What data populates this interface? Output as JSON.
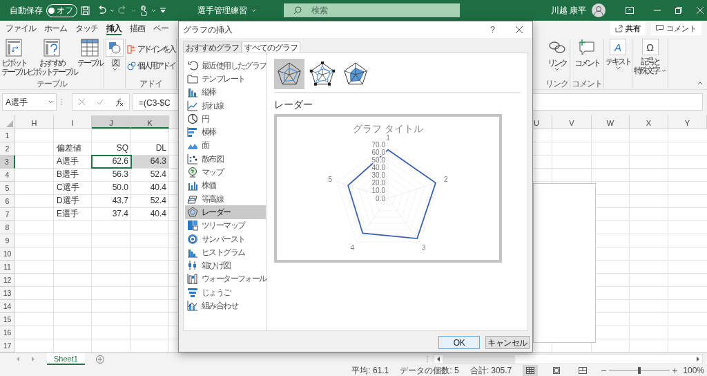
{
  "title_bar": {
    "autosave_label": "自動保存",
    "autosave_toggle": {
      "label": "オフ",
      "on": false
    },
    "file_name": "選手管理練習",
    "search": {
      "placeholder": "検索"
    },
    "user_name": "川越 康平"
  },
  "ribbon": {
    "tabs": [
      {
        "label": "ファイル",
        "selected": false
      },
      {
        "label": "ホーム",
        "selected": false
      },
      {
        "label": "タッチ",
        "selected": false
      },
      {
        "label": "挿入",
        "selected": true
      },
      {
        "label": "描画",
        "selected": false
      },
      {
        "label": "ペー",
        "selected": false
      }
    ],
    "share_button": "共有",
    "comment_button": "コメント",
    "left_groups": [
      {
        "label": "テーブル",
        "commands": [
          {
            "kind": "pivot",
            "lines": [
              "ピボット",
              "テーブル"
            ],
            "dropdown": false
          },
          {
            "kind": "recommended_pivot",
            "lines": [
              "おすすめ",
              "ピボットテーブル"
            ],
            "dropdown": false
          },
          {
            "kind": "table",
            "lines": [
              "テーブル"
            ],
            "dropdown": false
          }
        ]
      },
      {
        "commands": [
          {
            "kind": "illustrations",
            "lines": [
              "図"
            ],
            "dropdown": true
          }
        ]
      },
      {
        "label": "アドイ",
        "commands": [
          {
            "kind": "get_addins",
            "lines": [
              "アドインを入"
            ],
            "dropdown": false
          },
          {
            "kind": "my_addins",
            "lines": [
              "個人用アドイ"
            ],
            "dropdown": false
          }
        ]
      }
    ],
    "right_groups": [
      {
        "label": "リンク",
        "commands": [
          {
            "kind": "link",
            "lines": [
              "リンク"
            ],
            "dropdown": true
          }
        ]
      },
      {
        "label": "コメント",
        "commands": [
          {
            "kind": "comment",
            "lines": [
              "コメント"
            ],
            "dropdown": false
          }
        ]
      },
      {
        "commands": [
          {
            "kind": "text",
            "glyph": "A",
            "lines": [
              "テキスト"
            ],
            "dropdown": true
          }
        ]
      },
      {
        "commands": [
          {
            "kind": "symbols",
            "glyph": "Ω",
            "lines": [
              "記号と",
              "特殊文字"
            ],
            "dropdown": true
          }
        ]
      }
    ]
  },
  "formula_bar": {
    "name_box": "A選手",
    "formula": "=(C3-$C"
  },
  "sheet": {
    "columns": [
      {
        "label": "H",
        "selected": false
      },
      {
        "label": "I",
        "selected": false
      },
      {
        "label": "J",
        "selected": true
      },
      {
        "label": "K",
        "selected": true
      },
      {
        "label": "U",
        "selected": false
      },
      {
        "label": "V",
        "selected": false
      },
      {
        "label": "W",
        "selected": false
      },
      {
        "label": "X",
        "selected": false
      },
      {
        "label": "Y",
        "selected": false
      }
    ],
    "rows": [
      {
        "label": "1",
        "selected": false
      },
      {
        "label": "2",
        "selected": false,
        "cells": [
          {
            "kind": "text",
            "text": "偏差値",
            "selected": false,
            "active": false
          },
          {
            "kind": "number",
            "text": "SQ",
            "selected": false,
            "active": false
          },
          {
            "kind": "number",
            "text": "DL",
            "selected": false,
            "active": false
          }
        ]
      },
      {
        "label": "3",
        "selected": true,
        "cells": [
          {
            "kind": "text",
            "text": "A選手",
            "selected": false,
            "active": false
          },
          {
            "kind": "number",
            "text": "62.6",
            "selected": true,
            "active": true
          },
          {
            "kind": "number",
            "text": "64.3",
            "selected": true,
            "active": false
          }
        ]
      },
      {
        "label": "4",
        "selected": false,
        "cells": [
          {
            "kind": "text",
            "text": "B選手",
            "selected": false,
            "active": false
          },
          {
            "kind": "number",
            "text": "56.3",
            "selected": false,
            "active": false
          },
          {
            "kind": "number",
            "text": "52.4",
            "selected": false,
            "active": false
          }
        ]
      },
      {
        "label": "5",
        "selected": false,
        "cells": [
          {
            "kind": "text",
            "text": "C選手",
            "selected": false,
            "active": false
          },
          {
            "kind": "number",
            "text": "50.0",
            "selected": false,
            "active": false
          },
          {
            "kind": "number",
            "text": "40.4",
            "selected": false,
            "active": false
          }
        ]
      },
      {
        "label": "6",
        "selected": false,
        "cells": [
          {
            "kind": "text",
            "text": "D選手",
            "selected": false,
            "active": false
          },
          {
            "kind": "number",
            "text": "43.7",
            "selected": false,
            "active": false
          },
          {
            "kind": "number",
            "text": "52.4",
            "selected": false,
            "active": false
          }
        ]
      },
      {
        "label": "7",
        "selected": false,
        "cells": [
          {
            "kind": "text",
            "text": "E選手",
            "selected": false,
            "active": false
          },
          {
            "kind": "number",
            "text": "37.4",
            "selected": false,
            "active": false
          },
          {
            "kind": "number",
            "text": "40.4",
            "selected": false,
            "active": false
          }
        ]
      },
      {
        "label": "8",
        "selected": false
      },
      {
        "label": "9",
        "selected": false
      },
      {
        "label": "10",
        "selected": false
      },
      {
        "label": "11",
        "selected": false
      },
      {
        "label": "12",
        "selected": false
      },
      {
        "label": "13",
        "selected": false
      },
      {
        "label": "14",
        "selected": false
      },
      {
        "label": "15",
        "selected": false
      },
      {
        "label": "16",
        "selected": false
      },
      {
        "label": "17",
        "selected": false
      }
    ]
  },
  "sheet_tabs": [
    {
      "label": "Sheet1",
      "selected": true
    }
  ],
  "status_bar": {
    "average": "平均: 61.1",
    "count": "データの個数: 5",
    "sum": "合計: 305.7",
    "views": [
      {
        "kind": "normal",
        "selected": true
      },
      {
        "kind": "page_layout",
        "selected": false
      },
      {
        "kind": "page_break",
        "selected": false
      }
    ],
    "zoom_slider": {
      "level": 0.5
    },
    "zoom": "100%"
  },
  "dialog": {
    "title": "グラフの挿入",
    "help": "?",
    "tabs": [
      {
        "label": "おすすめグラフ",
        "selected": false
      },
      {
        "label": "すべてのグラフ",
        "selected": true
      }
    ],
    "chart_types": [
      {
        "kind": "recent",
        "label": "最近使用したグラフ",
        "selected": false
      },
      {
        "kind": "template",
        "label": "テンプレート",
        "selected": false
      },
      {
        "kind": "column",
        "label": "縦棒",
        "selected": false
      },
      {
        "kind": "line",
        "label": "折れ線",
        "selected": false
      },
      {
        "kind": "pie",
        "label": "円",
        "selected": false
      },
      {
        "kind": "bar",
        "label": "横棒",
        "selected": false
      },
      {
        "kind": "area",
        "label": "面",
        "selected": false
      },
      {
        "kind": "scatter",
        "label": "散布図",
        "selected": false
      },
      {
        "kind": "map",
        "label": "マップ",
        "selected": false
      },
      {
        "kind": "stock",
        "label": "株価",
        "selected": false
      },
      {
        "kind": "surface",
        "label": "等高線",
        "selected": false
      },
      {
        "kind": "radar",
        "label": "レーダー",
        "selected": true
      },
      {
        "kind": "treemap",
        "label": "ツリーマップ",
        "selected": false
      },
      {
        "kind": "sunburst",
        "label": "サンバースト",
        "selected": false
      },
      {
        "kind": "histogram",
        "label": "ヒストグラム",
        "selected": false
      },
      {
        "kind": "box",
        "label": "箱ひげ図",
        "selected": false
      },
      {
        "kind": "waterfall",
        "label": "ウォーターフォール",
        "selected": false
      },
      {
        "kind": "funnel",
        "label": "じょうご",
        "selected": false
      },
      {
        "kind": "combo",
        "label": "組み合わせ",
        "selected": false
      }
    ],
    "subtypes": [
      {
        "kind": "radar",
        "selected": true
      },
      {
        "kind": "markers",
        "selected": false
      },
      {
        "kind": "filled",
        "selected": false
      }
    ],
    "subtype_title": "レーダー",
    "preview": {
      "title": "グラフ タイトル",
      "ticks": [
        "70.0",
        "60.0",
        "50.0",
        "40.0",
        "30.0",
        "20.0",
        "10.0",
        "0.0"
      ],
      "axis_labels": [
        "1",
        "2",
        "3",
        "4",
        "5"
      ]
    },
    "buttons": [
      {
        "kind": "primary",
        "label": "OK"
      },
      {
        "kind": "secondary",
        "label": "キャンセル"
      }
    ]
  }
}
